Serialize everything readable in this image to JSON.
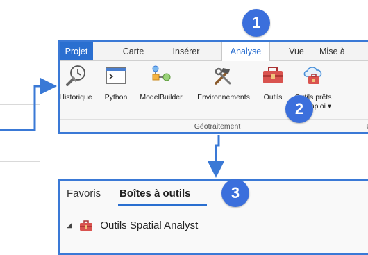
{
  "ribbon": {
    "tabs": [
      {
        "label": "Projet",
        "state": "project"
      },
      {
        "label": "Carte",
        "state": "normal"
      },
      {
        "label": "Insérer",
        "state": "normal"
      },
      {
        "label": "Analyse",
        "state": "active"
      },
      {
        "label": "Vue",
        "state": "normal"
      },
      {
        "label": "Mise à",
        "state": "normal"
      }
    ],
    "tools": [
      {
        "label": "Historique",
        "icon": "history-icon"
      },
      {
        "label": "Python",
        "icon": "python-window-icon"
      },
      {
        "label": "ModelBuilder",
        "icon": "modelbuilder-icon"
      },
      {
        "label": "Environnements",
        "icon": "environments-tools-icon"
      },
      {
        "label": "Outils",
        "icon": "toolbox-icon"
      },
      {
        "label_line1": "Outils prêts",
        "label_line2": "à l'emploi ▾",
        "icon": "ready-tools-cloud-icon"
      }
    ],
    "group_label": "Géotraitement",
    "launcher": "⧉"
  },
  "panel": {
    "tabs": [
      "Favoris",
      "Boîtes à outils"
    ],
    "active_tab": "Boîtes à outils",
    "tree_item": {
      "caret": "◢",
      "label": "Outils Spatial Analyst",
      "icon": "toolbox-icon"
    }
  },
  "callouts": [
    "1",
    "2",
    "3"
  ],
  "colors": {
    "accent": "#3a79d6",
    "badge": "#3b6fdc",
    "project_tab": "#2a6fd0",
    "toolbox_red": "#d9534f"
  }
}
